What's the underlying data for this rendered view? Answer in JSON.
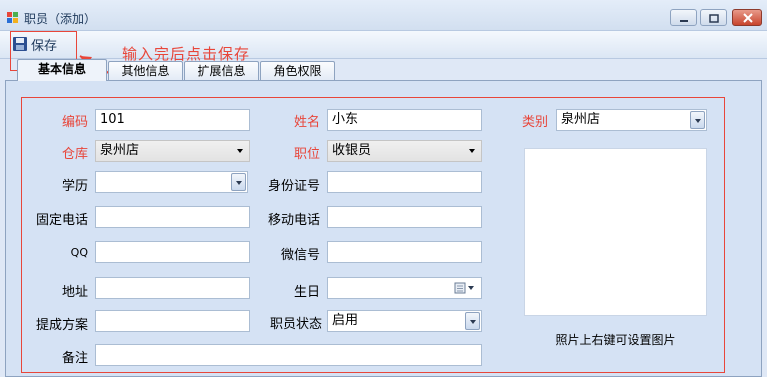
{
  "window": {
    "title": "职员（添加）"
  },
  "toolbar": {
    "save_label": "保存"
  },
  "annotation": {
    "text": "输入完后点击保存"
  },
  "tabs": [
    {
      "label": "基本信息",
      "active": true
    },
    {
      "label": "其他信息",
      "active": false
    },
    {
      "label": "扩展信息",
      "active": false
    },
    {
      "label": "角色权限",
      "active": false
    }
  ],
  "form": {
    "code": {
      "label": "编码",
      "value": "101",
      "required": true
    },
    "name": {
      "label": "姓名",
      "value": "小东",
      "required": true
    },
    "category": {
      "label": "类别",
      "value": "泉州店",
      "required": true
    },
    "warehouse": {
      "label": "仓库",
      "value": "泉州店",
      "required": true
    },
    "position": {
      "label": "职位",
      "value": "收银员",
      "required": true
    },
    "education": {
      "label": "学历",
      "value": ""
    },
    "id_card": {
      "label": "身份证号",
      "value": ""
    },
    "phone": {
      "label": "固定电话",
      "value": ""
    },
    "mobile": {
      "label": "移动电话",
      "value": ""
    },
    "qq": {
      "label": "QQ",
      "value": ""
    },
    "wechat": {
      "label": "微信号",
      "value": ""
    },
    "address": {
      "label": "地址",
      "value": ""
    },
    "birthday": {
      "label": "生日",
      "value": ""
    },
    "commission": {
      "label": "提成方案",
      "value": ""
    },
    "status": {
      "label": "职员状态",
      "value": "启用"
    },
    "remark": {
      "label": "备注",
      "value": ""
    }
  },
  "photo": {
    "hint": "照片上右键可设置图片"
  },
  "colors": {
    "required_label": "#e8463a",
    "annotation": "#e8463a",
    "window_bg": "#dfe8f6"
  }
}
